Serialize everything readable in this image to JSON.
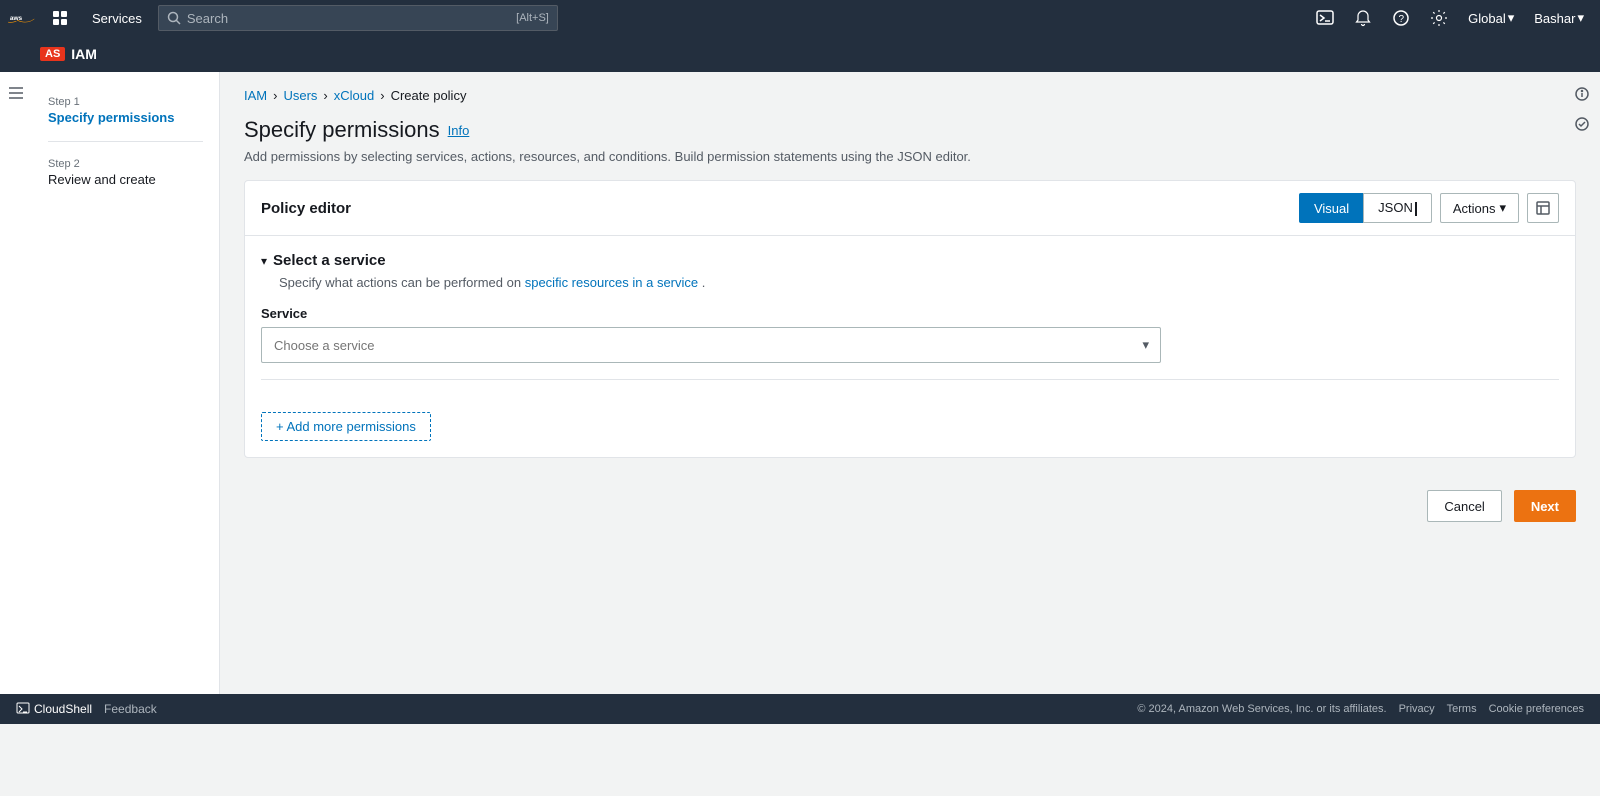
{
  "topnav": {
    "aws_logo": "AWS",
    "services_label": "Services",
    "search_placeholder": "Search",
    "search_shortcut": "[Alt+S]",
    "global_label": "Global",
    "user_label": "Bashar",
    "user_caret": "▾"
  },
  "service_header": {
    "badge": "AS",
    "service_name": "IAM"
  },
  "breadcrumb": {
    "iam": "IAM",
    "users": "Users",
    "xcloud": "xCloud",
    "current": "Create policy"
  },
  "sidebar": {
    "step1_label": "Step 1",
    "step1_title": "Specify permissions",
    "step2_label": "Step 2",
    "step2_title": "Review and create"
  },
  "page": {
    "title": "Specify permissions",
    "info_link": "Info",
    "description": "Add permissions by selecting services, actions, resources, and conditions. Build permission statements using the JSON editor."
  },
  "policy_editor": {
    "title": "Policy editor",
    "btn_visual": "Visual",
    "btn_json": "JSON",
    "btn_actions": "Actions",
    "btn_actions_caret": "▾"
  },
  "select_service": {
    "section_title": "Select a service",
    "section_desc_plain": "Specify what actions can be performed on",
    "section_desc_link": "specific resources in a service",
    "section_desc_end": ".",
    "service_label": "Service",
    "service_placeholder": "Choose a service"
  },
  "buttons": {
    "add_permissions": "+ Add more permissions",
    "cancel": "Cancel",
    "next": "Next"
  },
  "footer": {
    "cloudshell": "CloudShell",
    "feedback": "Feedback",
    "copyright": "© 2024, Amazon Web Services, Inc. or its affiliates.",
    "privacy": "Privacy",
    "terms": "Terms",
    "cookie_preferences": "Cookie preferences"
  }
}
